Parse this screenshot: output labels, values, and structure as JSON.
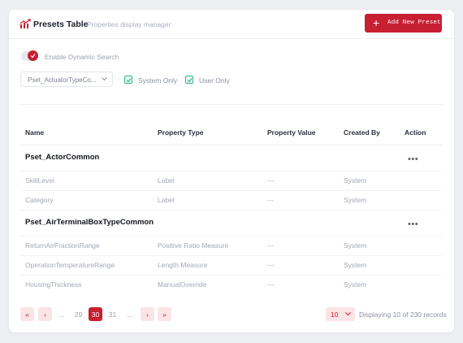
{
  "header": {
    "title": "Presets Table",
    "subtitle": "Properties display manager",
    "add_button": "Add New Preset",
    "add_icon": "+"
  },
  "filters": {
    "dynamic_search_label": "Enable Dynamic Search",
    "dynamic_search_on": true,
    "pset_select_value": "Pset_ActuatorTypeCo...",
    "system_only_label": "System Only",
    "system_only_checked": true,
    "user_only_label": "User Only",
    "user_only_checked": true
  },
  "table": {
    "columns": [
      "Name",
      "Property Type",
      "Property Value",
      "Created By",
      "Action"
    ],
    "action_glyph": "•••",
    "groups": [
      {
        "name": "Pset_ActorCommon",
        "rows": [
          {
            "name": "SkillLevel",
            "type": "Label",
            "value": "---",
            "created_by": "System"
          },
          {
            "name": "Category",
            "type": "Label",
            "value": "---",
            "created_by": "System"
          }
        ]
      },
      {
        "name": "Pset_AirTerminalBoxTypeCommon",
        "rows": [
          {
            "name": "ReturnAirFractionRange",
            "type": "Positive Ratio Measure",
            "value": "---",
            "created_by": "System"
          },
          {
            "name": "OperationTemperatureRange",
            "type": "Length Measure",
            "value": "---",
            "created_by": "System"
          },
          {
            "name": "HousingThickness",
            "type": "ManualOverride",
            "value": "---",
            "created_by": "System"
          }
        ]
      }
    ]
  },
  "pagination": {
    "first": "«",
    "prev": "‹",
    "next": "›",
    "last": "»",
    "ellipsis": "...",
    "pages": [
      "29",
      "30",
      "31"
    ],
    "current": "30",
    "per_page": "10",
    "records_text": "Displaying 10 of 230 records"
  },
  "colors": {
    "accent": "#c81f33",
    "check": "#2bb58e"
  }
}
